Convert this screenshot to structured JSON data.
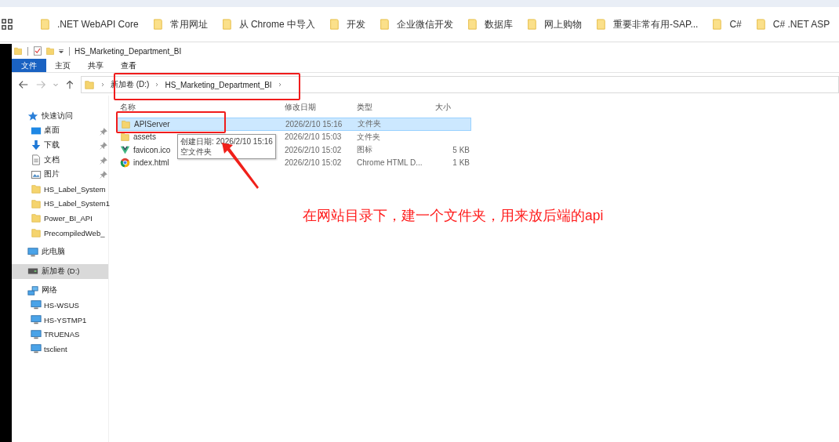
{
  "browser": {
    "bookmarks": [
      ".NET WebAPI Core",
      "常用网址",
      "从 Chrome 中导入",
      "开发",
      "企业微信开发",
      "数据库",
      "网上购物",
      "重要非常有用-SAP...",
      "C#",
      "C# .NET ASP"
    ]
  },
  "explorer": {
    "title": "HS_Marketing_Department_BI",
    "ribbon_tabs": [
      {
        "label": "文件",
        "selected": true
      },
      {
        "label": "主页",
        "selected": false
      },
      {
        "label": "共享",
        "selected": false
      },
      {
        "label": "查看",
        "selected": false
      }
    ],
    "breadcrumb": [
      "新加卷 (D:)",
      "HS_Marketing_Department_BI"
    ],
    "nav": [
      {
        "label": "快速访问",
        "kind": "star",
        "selected": false,
        "children": [
          {
            "label": "桌面",
            "kind": "desktop",
            "pinned": true,
            "selected": false
          },
          {
            "label": "下载",
            "kind": "download",
            "pinned": true,
            "selected": false
          },
          {
            "label": "文档",
            "kind": "document",
            "pinned": true,
            "selected": false
          },
          {
            "label": "图片",
            "kind": "picture",
            "pinned": true,
            "selected": false
          },
          {
            "label": "HS_Label_System",
            "kind": "folder",
            "pinned": false,
            "selected": false
          },
          {
            "label": "HS_Label_System1",
            "kind": "folder",
            "pinned": false,
            "selected": false
          },
          {
            "label": "Power_BI_API",
            "kind": "folder",
            "pinned": false,
            "selected": false
          },
          {
            "label": "PrecompiledWeb_",
            "kind": "folder",
            "pinned": false,
            "selected": false
          }
        ]
      },
      {
        "label": "此电脑",
        "kind": "pc",
        "selected": false
      },
      {
        "label": "新加卷 (D:)",
        "kind": "drive",
        "selected": true
      },
      {
        "label": "网络",
        "kind": "network",
        "selected": false,
        "children": [
          {
            "label": "HS-WSUS",
            "kind": "computer",
            "selected": false
          },
          {
            "label": "HS-YSTMP1",
            "kind": "computer",
            "selected": false
          },
          {
            "label": "TRUENAS",
            "kind": "computer",
            "selected": false
          },
          {
            "label": "tsclient",
            "kind": "computer",
            "selected": false
          }
        ]
      }
    ],
    "columns": [
      "名称",
      "修改日期",
      "类型",
      "大小"
    ],
    "files": [
      {
        "name": "APIServer",
        "modified": "2026/2/10 15:16",
        "type": "文件夹",
        "kind": "folder",
        "selected": true
      },
      {
        "name": "assets",
        "modified": "2026/2/10 15:03",
        "type": "文件夹",
        "kind": "folder",
        "selected": false
      },
      {
        "name": "favicon.ico",
        "modified": "2026/2/10 15:02",
        "type": "图标",
        "size": "5 KB",
        "kind": "vue",
        "selected": false
      },
      {
        "name": "index.html",
        "modified": "2026/2/10 15:02",
        "type": "Chrome HTML D...",
        "size": "1 KB",
        "kind": "chrome",
        "selected": false
      }
    ],
    "tooltip": [
      "创建日期: 2026/2/10 15:16",
      "空文件夹"
    ]
  },
  "annotation": "在网站目录下，建一个文件夹，用来放后端的api"
}
